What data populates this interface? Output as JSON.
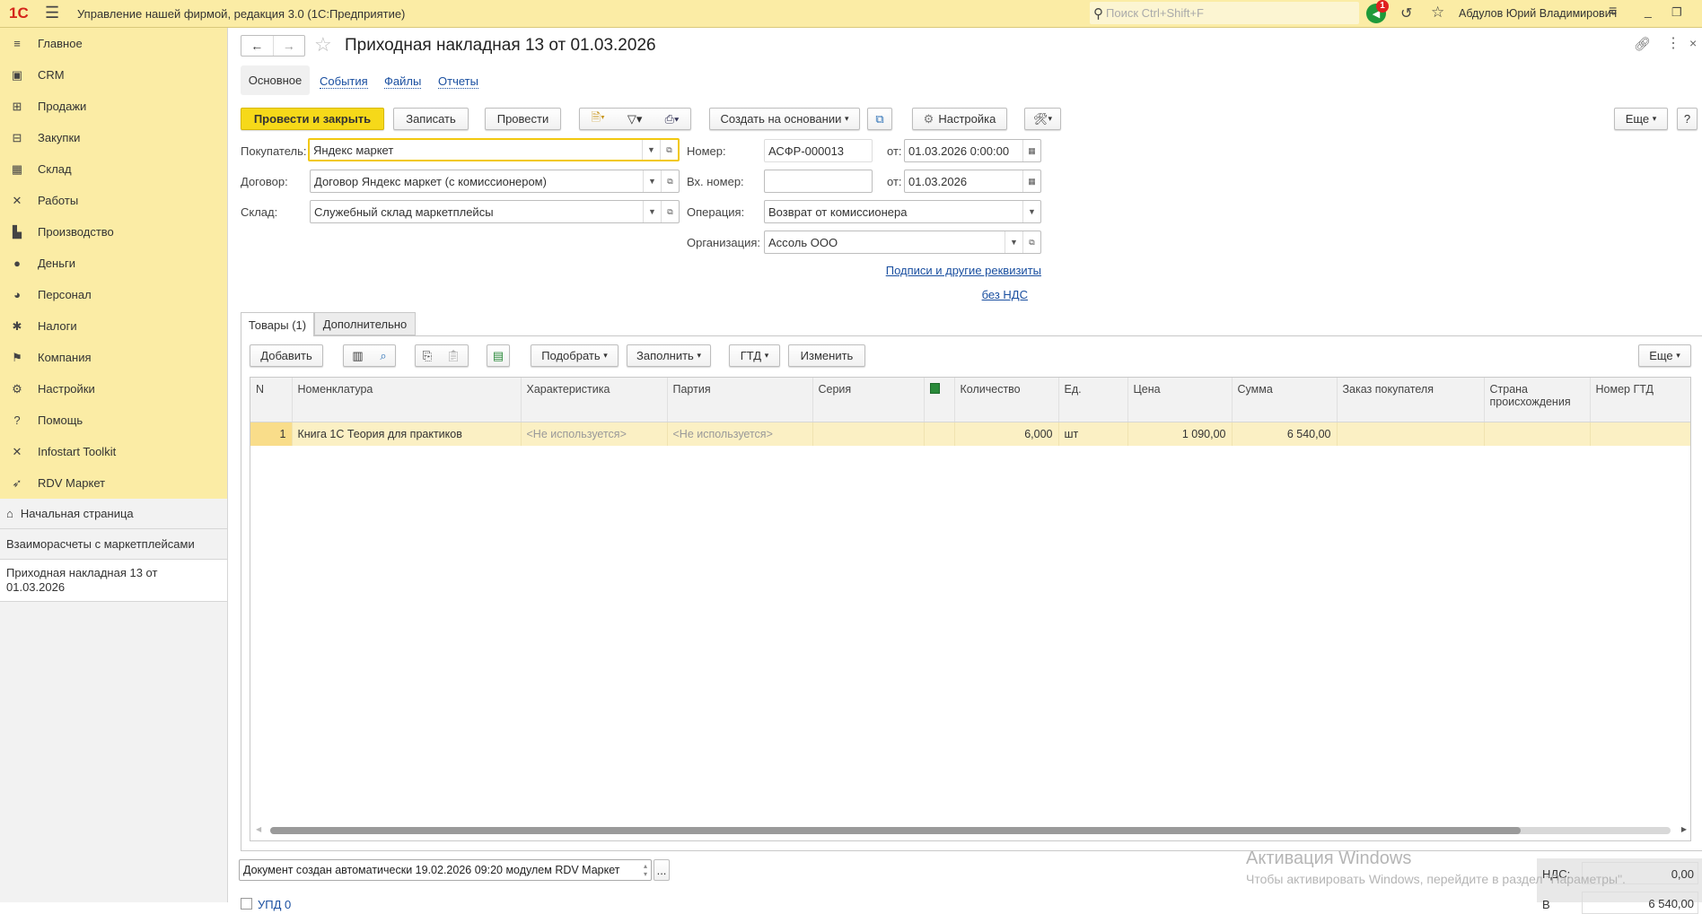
{
  "topbar": {
    "app_title": "Управление нашей фирмой, редакция 3.0  (1С:Предприятие)",
    "search_placeholder": "Поиск Ctrl+Shift+F",
    "notifications_count": "1",
    "user": "Абдулов Юрий Владимирович"
  },
  "sidebar": {
    "items": [
      {
        "label": "Главное",
        "icon": "menu-icon"
      },
      {
        "label": "CRM",
        "icon": "crm-icon"
      },
      {
        "label": "Продажи",
        "icon": "basket-icon"
      },
      {
        "label": "Закупки",
        "icon": "purchases-icon"
      },
      {
        "label": "Склад",
        "icon": "warehouse-icon"
      },
      {
        "label": "Работы",
        "icon": "tools-icon"
      },
      {
        "label": "Производство",
        "icon": "factory-icon"
      },
      {
        "label": "Деньги",
        "icon": "money-icon"
      },
      {
        "label": "Персонал",
        "icon": "people-icon"
      },
      {
        "label": "Налоги",
        "icon": "taxes-icon"
      },
      {
        "label": "Компания",
        "icon": "flag-icon"
      },
      {
        "label": "Настройки",
        "icon": "gear-icon"
      },
      {
        "label": "Помощь",
        "icon": "help-icon"
      },
      {
        "label": "Infostart Toolkit",
        "icon": "toolkit-icon"
      },
      {
        "label": "RDV Маркет",
        "icon": "rocket-icon"
      }
    ],
    "open_windows": [
      "Начальная страница",
      "Взаиморасчеты с маркетплейсами",
      "Приходная накладная 13 от 01.03.2026"
    ]
  },
  "doc": {
    "title": "Приходная накладная 13 от 01.03.2026",
    "tabs": [
      "Основное",
      "События",
      "Файлы",
      "Отчеты"
    ],
    "toolbar": {
      "post_close": "Провести и закрыть",
      "save": "Записать",
      "post": "Провести",
      "create_based": "Создать на основании",
      "settings": "Настройка",
      "more": "Еще",
      "help": "?"
    },
    "fields": {
      "buyer_label": "Покупатель:",
      "buyer": "Яндекс маркет",
      "contract_label": "Договор:",
      "contract": "Договор Яндекс маркет (с комиссионером)",
      "warehouse_label": "Склад:",
      "warehouse": "Служебный склад маркетплейсы",
      "number_label": "Номер:",
      "number": "АСФР-000013",
      "from_label": "от:",
      "date": "01.03.2026  0:00:00",
      "in_number_label": "Вх. номер:",
      "in_number": "",
      "in_date": "01.03.2026",
      "operation_label": "Операция:",
      "operation": "Возврат от комиссионера",
      "org_label": "Организация:",
      "org": "Ассоль ООО",
      "signatures_link": "Подписи и другие реквизиты",
      "vat_link": "без НДС"
    },
    "inner_tabs": [
      "Товары (1)",
      "Дополнительно"
    ],
    "table_toolbar": {
      "add": "Добавить",
      "pick": "Подобрать",
      "fill": "Заполнить",
      "gtd": "ГТД",
      "change": "Изменить",
      "more": "Еще"
    },
    "table": {
      "columns": [
        "N",
        "Номенклатура",
        "Характеристика",
        "Партия",
        "Серия",
        "",
        "Количество",
        "Ед.",
        "Цена",
        "Сумма",
        "Заказ покупателя",
        "Страна происхождения",
        "Номер ГТД"
      ],
      "rows": [
        [
          "1",
          "Книга 1С Теория для практиков",
          "<Не используется>",
          "<Не используется>",
          "",
          "",
          "6,000",
          "шт",
          "1 090,00",
          "6 540,00",
          "",
          "",
          ""
        ]
      ]
    },
    "comment": "Документ создан автоматически 19.02.2026 09:20 модулем RDV Маркет",
    "comment_btn": "...",
    "totals": {
      "vat_label": "НДС:",
      "vat": "0,00",
      "total_label": "В",
      "total": "6 540,00"
    },
    "upd_label": "УПД 0"
  },
  "watermark": {
    "title": "Активация Windows",
    "text": "Чтобы активировать Windows, перейдите в раздел \"Параметры\"."
  }
}
